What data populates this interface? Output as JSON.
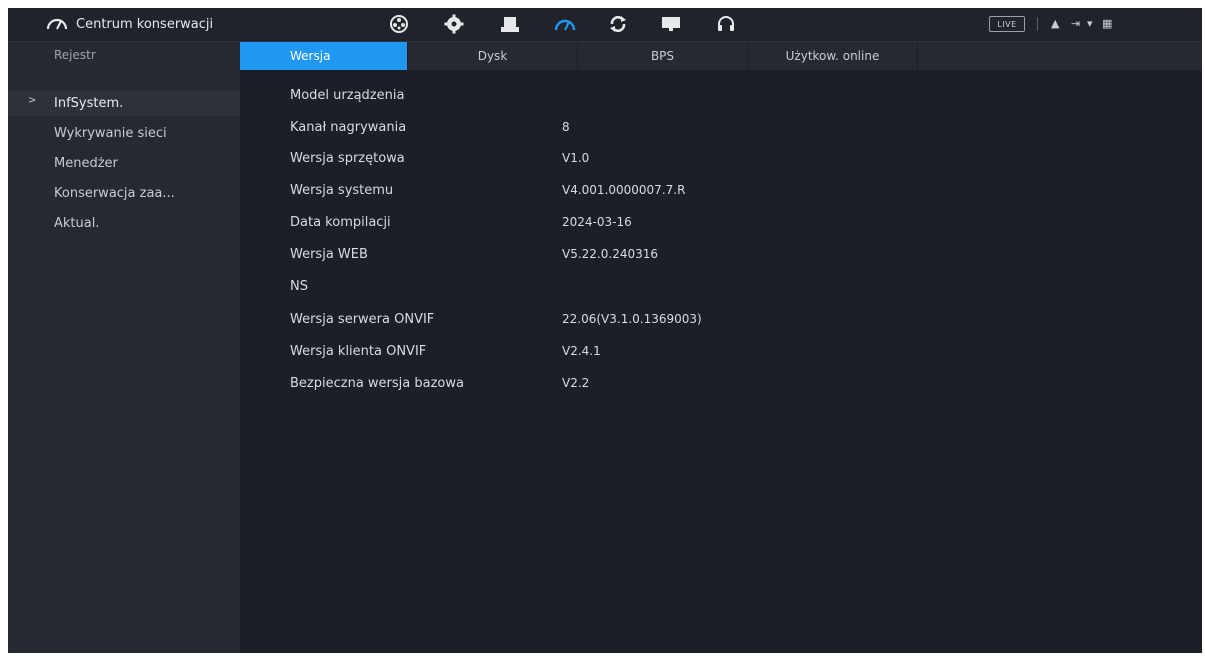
{
  "header": {
    "title": "Centrum konserwacji",
    "icons": [
      "gauge-icon",
      "camera-reel-icon",
      "gear-flower-icon",
      "storage-icon",
      "gauge-active-icon",
      "sync-icon",
      "monitor-icon",
      "headset-icon"
    ],
    "live_label": "LIVE",
    "accent": "#2097f2"
  },
  "sidebar": {
    "header": "Rejestr",
    "items": [
      {
        "label": "InfSystem.",
        "active": true
      },
      {
        "label": "Wykrywanie sieci",
        "active": false
      },
      {
        "label": "Menedżer",
        "active": false
      },
      {
        "label": "Konserwacja zaa...",
        "active": false
      },
      {
        "label": "Aktual.",
        "active": false
      }
    ]
  },
  "tabs": [
    {
      "label": "Wersja",
      "active": true
    },
    {
      "label": "Dysk",
      "active": false
    },
    {
      "label": "BPS",
      "active": false
    },
    {
      "label": "Użytkow. online",
      "active": false
    }
  ],
  "info": [
    {
      "key": "Model urządzenia",
      "value": ""
    },
    {
      "key": "Kanał nagrywania",
      "value": "8"
    },
    {
      "key": "Wersja sprzętowa",
      "value": "V1.0"
    },
    {
      "key": "Wersja systemu",
      "value": "V4.001.0000007.7.R"
    },
    {
      "key": "Data kompilacji",
      "value": "2024-03-16"
    },
    {
      "key": "Wersja WEB",
      "value": "V5.22.0.240316"
    },
    {
      "key": "NS",
      "value": ""
    },
    {
      "key": "Wersja serwera ONVIF",
      "value": "22.06(V3.1.0.1369003)"
    },
    {
      "key": "Wersja klienta ONVIF",
      "value": "V2.4.1"
    },
    {
      "key": "Bezpieczna wersja bazowa",
      "value": "V2.2"
    }
  ]
}
